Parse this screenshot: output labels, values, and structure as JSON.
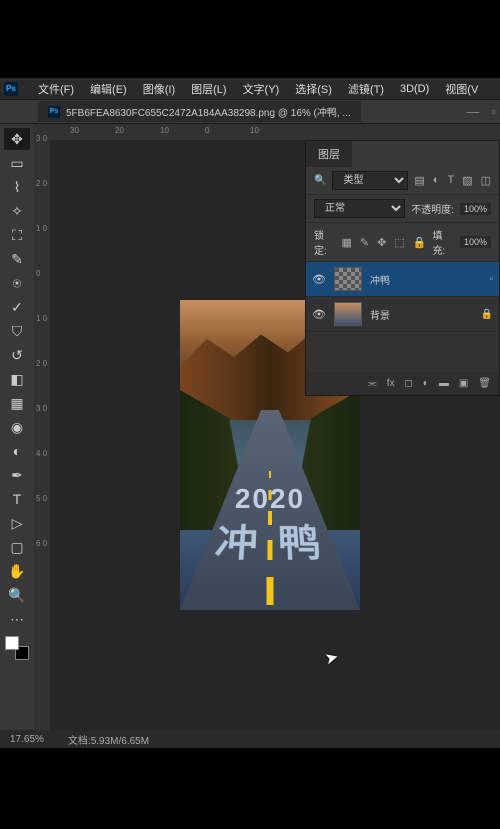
{
  "menu": {
    "file": "文件(F)",
    "edit": "编辑(E)",
    "image": "图像(I)",
    "layer": "图层(L)",
    "type": "文字(Y)",
    "select": "选择(S)",
    "filter": "滤镜(T)",
    "threed": "3D(D)",
    "view": "视图(V"
  },
  "doc": {
    "title": "5FB6FEA8630FC655C2472A184AA38298.png @ 16% (冲鸭, ..."
  },
  "ruler_h": {
    "m30": "30",
    "m20": "20",
    "m10": "10",
    "zero": "0",
    "p10": "10"
  },
  "ruler_v": {
    "r30": "3\n0",
    "r20": "2\n0",
    "r10": "1\n0",
    "r0": "0",
    "rn10": "1\n0",
    "rn20": "2\n0",
    "rn30": "3\n0",
    "rn40": "4\n0",
    "rn50": "5\n0",
    "rn60": "6\n0"
  },
  "canvas": {
    "year": "2020",
    "text": "冲 鸭"
  },
  "panel": {
    "tab": "图层",
    "kind_label": "类型",
    "blend": "正常",
    "opacity_label": "不透明度:",
    "opacity_val": "100%",
    "lock_label": "锁定:",
    "fill_label": "填充:",
    "fill_val": "100%"
  },
  "layers": [
    {
      "name": "冲鸭",
      "selected": true,
      "thumb": "checker",
      "lock": ""
    },
    {
      "name": "背景",
      "selected": false,
      "thumb": "img",
      "lock": "🔒"
    }
  ],
  "footer": {
    "fx": "fx",
    "mask": "◻",
    "adj": "◐",
    "group": "▬",
    "new": "▣",
    "trash": "🗑"
  },
  "status": {
    "zoom": "17.65%",
    "docinfo": "文档:5.93M/6.65M"
  }
}
